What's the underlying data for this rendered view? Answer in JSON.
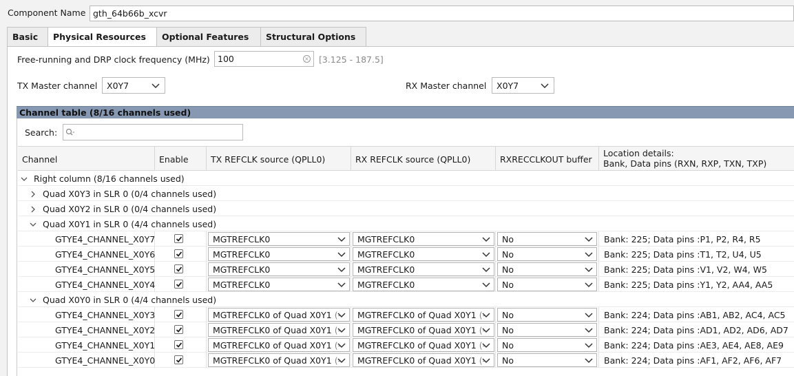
{
  "component": {
    "label": "Component Name",
    "value": "gth_64b66b_xcvr"
  },
  "tabs": [
    {
      "label": "Basic",
      "active": false
    },
    {
      "label": "Physical Resources",
      "active": true
    },
    {
      "label": "Optional Features",
      "active": false
    },
    {
      "label": "Structural Options",
      "active": false
    }
  ],
  "clock": {
    "label": "Free-running and DRP clock frequency (MHz)",
    "value": "100",
    "range": "[3.125 - 187.5]"
  },
  "tx_master": {
    "label": "TX Master channel",
    "value": "X0Y7"
  },
  "rx_master": {
    "label": "RX Master channel",
    "value": "X0Y7"
  },
  "channel_table": {
    "title": "Channel table (8/16 channels used)",
    "search_label": "Search:",
    "search_placeholder": "",
    "columns": [
      "Channel",
      "Enable",
      "TX REFCLK source (QPLL0)",
      "RX REFCLK source (QPLL0)",
      "RXRECCLKOUT buffer",
      "Location details:",
      "Bank, Data pins (RXN, RXP, TXN, TXP)"
    ],
    "groups": {
      "right_column": "Right column (8/16 channels used)",
      "quad_x0y3": "Quad X0Y3 in SLR 0 (0/4 channels used)",
      "quad_x0y2": "Quad X0Y2 in SLR 0 (0/4 channels used)",
      "quad_x0y1": "Quad X0Y1 in SLR 0 (4/4 channels used)",
      "quad_x0y0": "Quad X0Y0 in SLR 0 (4/4 channels used)"
    },
    "rows": [
      {
        "channel": "GTYE4_CHANNEL_X0Y7",
        "enabled": true,
        "tx": "MGTREFCLK0",
        "tx_suffix": "",
        "rx": "MGTREFCLK0",
        "rx_suffix": "",
        "buffer": "No",
        "location": "Bank: 225; Data pins :P1, P2, R4, R5"
      },
      {
        "channel": "GTYE4_CHANNEL_X0Y6",
        "enabled": true,
        "tx": "MGTREFCLK0",
        "tx_suffix": "",
        "rx": "MGTREFCLK0",
        "rx_suffix": "",
        "buffer": "No",
        "location": "Bank: 225; Data pins :T1, T2, U4, U5"
      },
      {
        "channel": "GTYE4_CHANNEL_X0Y5",
        "enabled": true,
        "tx": "MGTREFCLK0",
        "tx_suffix": "",
        "rx": "MGTREFCLK0",
        "rx_suffix": "",
        "buffer": "No",
        "location": "Bank: 225; Data pins :V1, V2, W4, W5"
      },
      {
        "channel": "GTYE4_CHANNEL_X0Y4",
        "enabled": true,
        "tx": "MGTREFCLK0",
        "tx_suffix": "",
        "rx": "MGTREFCLK0",
        "rx_suffix": "",
        "buffer": "No",
        "location": "Bank: 225; Data pins :Y1, Y2, AA4, AA5"
      },
      {
        "channel": "GTYE4_CHANNEL_X0Y3",
        "enabled": true,
        "tx": "MGTREFCLK0 of Quad X0Y1",
        "tx_suffix": "(-",
        "rx": "MGTREFCLK0 of Quad X0Y1",
        "rx_suffix": "(-",
        "buffer": "No",
        "location": "Bank: 224; Data pins :AB1, AB2, AC4, AC5"
      },
      {
        "channel": "GTYE4_CHANNEL_X0Y2",
        "enabled": true,
        "tx": "MGTREFCLK0 of Quad X0Y1",
        "tx_suffix": "(-",
        "rx": "MGTREFCLK0 of Quad X0Y1",
        "rx_suffix": "(-",
        "buffer": "No",
        "location": "Bank: 224; Data pins :AD1, AD2, AD6, AD7"
      },
      {
        "channel": "GTYE4_CHANNEL_X0Y1",
        "enabled": true,
        "tx": "MGTREFCLK0 of Quad X0Y1",
        "tx_suffix": "(-",
        "rx": "MGTREFCLK0 of Quad X0Y1",
        "rx_suffix": "(-",
        "buffer": "No",
        "location": "Bank: 224; Data pins :AE3, AE4, AE8, AE9"
      },
      {
        "channel": "GTYE4_CHANNEL_X0Y0",
        "enabled": true,
        "tx": "MGTREFCLK0 of Quad X0Y1",
        "tx_suffix": "(-",
        "rx": "MGTREFCLK0 of Quad X0Y1",
        "rx_suffix": "(-",
        "buffer": "No",
        "location": "Bank: 224; Data pins :AF1, AF2, AF6, AF7"
      }
    ]
  }
}
